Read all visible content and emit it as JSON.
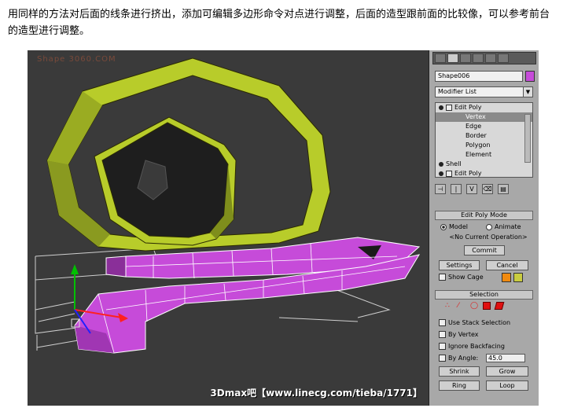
{
  "caption": "用同样的方法对后面的线条进行挤出，添加可编辑多边形命令对点进行调整，后面的造型跟前面的比较像，可以参考前台的造型进行调整。",
  "viewport": {
    "watermark_top": "Shape 3060.COM",
    "watermark_bottom": "3Dmax吧【www.linecg.com/tieba/1771】"
  },
  "panel": {
    "object_name": "Shape006",
    "object_color": "#c64bd9",
    "modifier_list_label": "Modifier List",
    "stack": {
      "edit_poly": "Edit Poly",
      "sub_items": [
        "Vertex",
        "Edge",
        "Border",
        "Polygon",
        "Element"
      ],
      "shell": "Shell",
      "edit_poly_2": "Edit Poly"
    },
    "edit_poly_mode": {
      "title": "Edit Poly Mode",
      "model": "Model",
      "animate": "Animate",
      "status": "<No Current Operation>",
      "commit": "Commit",
      "settings": "Settings",
      "cancel": "Cancel",
      "show_cage": "Show Cage",
      "cage_color_1": "#f08a10",
      "cage_color_2": "#c9cc40"
    },
    "selection": {
      "title": "Selection",
      "use_stack_selection": "Use Stack Selection",
      "by_vertex": "By Vertex",
      "ignore_backfacing": "Ignore Backfacing",
      "by_angle": "By Angle:",
      "angle_value": "45.0",
      "shrink": "Shrink",
      "grow": "Grow",
      "ring": "Ring",
      "loop": "Loop"
    }
  },
  "colors": {
    "shape_green": "#b8cc2a",
    "shape_magenta": "#c64bd9",
    "viewport_bg": "#3a3a3a"
  }
}
